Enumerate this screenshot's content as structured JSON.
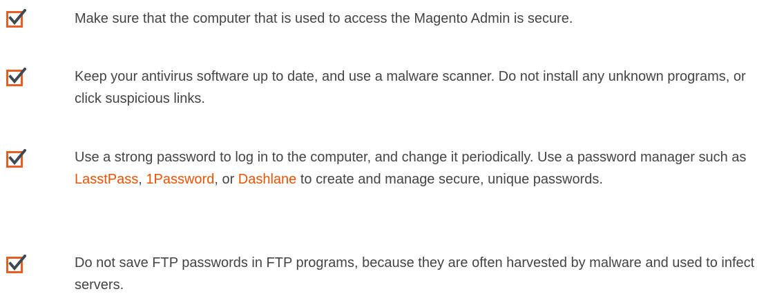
{
  "colors": {
    "check_box": "#e85d22",
    "check_mark": "#3d4a52",
    "body_text": "#444444",
    "link": "#eb5202"
  },
  "icons": {
    "check": "checkbox-checked-icon"
  },
  "checklist": {
    "items": [
      {
        "text": "Make sure that the computer that is used to access the Magento Admin is secure."
      },
      {
        "text": "Keep your antivirus software up to date, and use a malware scanner. Do not install any unknown programs, or click suspicious links."
      },
      {
        "text_before": "Use a strong password to log in to the computer, and change it periodically. Use a password manager such as ",
        "link1": "LasstPass",
        "sep1": ", ",
        "link2": "1Password",
        "sep2": ", or ",
        "link3": "Dashlane",
        "text_after": " to create and manage secure, unique passwords."
      },
      {
        "text": "Do not save FTP passwords in FTP programs, because they are often harvested by malware and used to infect servers."
      }
    ]
  }
}
